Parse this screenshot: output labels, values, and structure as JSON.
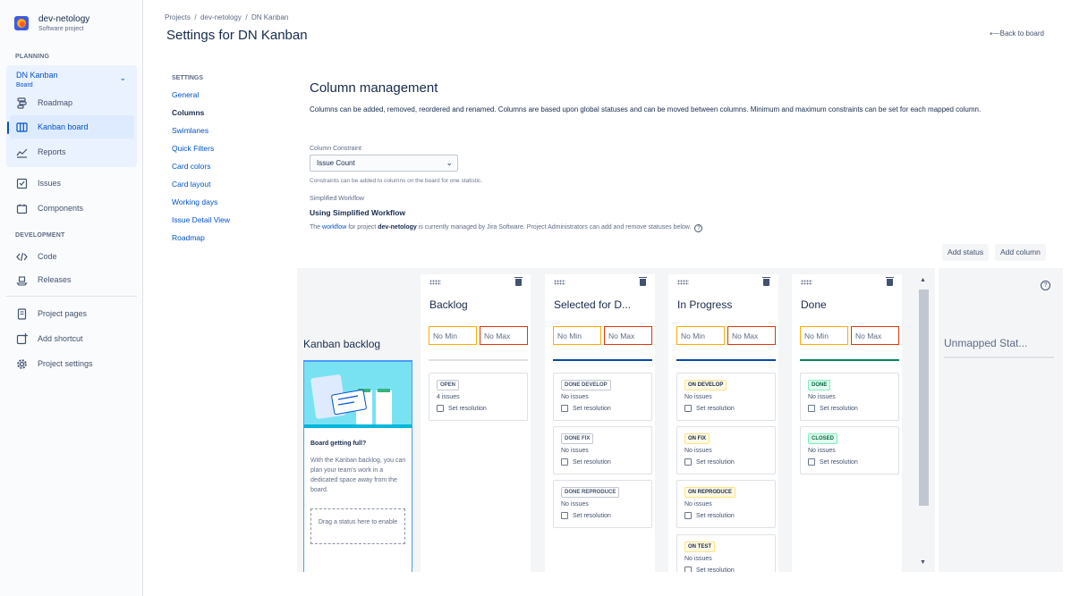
{
  "project": {
    "name": "dev-netology",
    "type": "Software project"
  },
  "sidebar": {
    "planning_label": "PLANNING",
    "board": {
      "name": "DN Kanban",
      "sub": "Board"
    },
    "planning_items": [
      {
        "label": "Roadmap",
        "icon": "roadmap-icon"
      },
      {
        "label": "Kanban board",
        "icon": "board-icon"
      },
      {
        "label": "Reports",
        "icon": "reports-icon"
      }
    ],
    "items": [
      {
        "label": "Issues",
        "icon": "issues-icon"
      },
      {
        "label": "Components",
        "icon": "components-icon"
      }
    ],
    "development_label": "DEVELOPMENT",
    "dev_items": [
      {
        "label": "Code",
        "icon": "code-icon"
      },
      {
        "label": "Releases",
        "icon": "releases-icon"
      }
    ],
    "bottom_items": [
      {
        "label": "Project pages",
        "icon": "pages-icon"
      },
      {
        "label": "Add shortcut",
        "icon": "add-shortcut-icon"
      },
      {
        "label": "Project settings",
        "icon": "gear-icon"
      }
    ]
  },
  "header": {
    "breadcrumb": [
      "Projects",
      "dev-netology",
      "DN Kanban"
    ],
    "separator": "/",
    "title": "Settings for DN Kanban",
    "back_link": "⟵Back to board"
  },
  "settings_nav": {
    "heading": "SETTINGS",
    "links": [
      "General",
      "Columns",
      "Swimlanes",
      "Quick Filters",
      "Card colors",
      "Card layout",
      "Working days",
      "Issue Detail View",
      "Roadmap"
    ],
    "active": "Columns"
  },
  "main": {
    "title": "Column management",
    "description": "Columns can be added, removed, reordered and renamed. Columns are based upon global statuses and can be moved between columns. Minimum and maximum constraints can be set for each mapped column.",
    "constraint_label": "Column Constraint",
    "constraint_value": "Issue Count",
    "constraint_note": "Constraints can be added to columns on the board for one statistic.",
    "workflow_label": "Simplified Workflow",
    "workflow_title": "Using Simplified Workflow",
    "workflow_desc_pre": "The ",
    "workflow_link": "workflow",
    "workflow_desc_mid": " for project ",
    "workflow_project": "dev-netology",
    "workflow_desc_post": " is currently managed by Jira Software. Project Administrators can add and remove statuses below.",
    "help_glyph": "?",
    "add_status": "Add status",
    "add_column": "Add column"
  },
  "board": {
    "backlog": {
      "title": "Kanban backlog",
      "heading": "Board getting full?",
      "text": "With the Kanban backlog, you can plan your team's work in a dedicated space away from the board.",
      "drop": "Drag a status here to enable"
    },
    "min_placeholder": "No Min",
    "max_placeholder": "No Max",
    "set_resolution": "Set resolution",
    "columns": [
      {
        "name": "Backlog",
        "rule_color": "#DFE1E6",
        "statuses": [
          {
            "name": "OPEN",
            "count": "4 issues",
            "tone": "grey"
          }
        ]
      },
      {
        "name": "Selected for D...",
        "rule_color": "#0747A6",
        "statuses": [
          {
            "name": "DONE DEVELOP",
            "count": "No issues",
            "tone": "grey"
          },
          {
            "name": "DONE FIX",
            "count": "No issues",
            "tone": "grey"
          },
          {
            "name": "DONE REPRODUCE",
            "count": "No issues",
            "tone": "grey"
          }
        ]
      },
      {
        "name": "In Progress",
        "rule_color": "#0747A6",
        "statuses": [
          {
            "name": "ON DEVELOP",
            "count": "No issues",
            "tone": "yellow"
          },
          {
            "name": "ON FIX",
            "count": "No issues",
            "tone": "yellow"
          },
          {
            "name": "ON REPRODUCE",
            "count": "No issues",
            "tone": "yellow"
          },
          {
            "name": "ON TEST",
            "count": "No issues",
            "tone": "yellow"
          }
        ]
      },
      {
        "name": "Done",
        "rule_color": "#00875A",
        "statuses": [
          {
            "name": "DONE",
            "count": "No issues",
            "tone": "green"
          },
          {
            "name": "CLOSED",
            "count": "No issues",
            "tone": "green"
          }
        ]
      }
    ],
    "unmapped_title": "Unmapped Stat...",
    "unmapped_help": "?",
    "scroll_up_glyph": "▲",
    "scroll_down_glyph": "▼"
  }
}
